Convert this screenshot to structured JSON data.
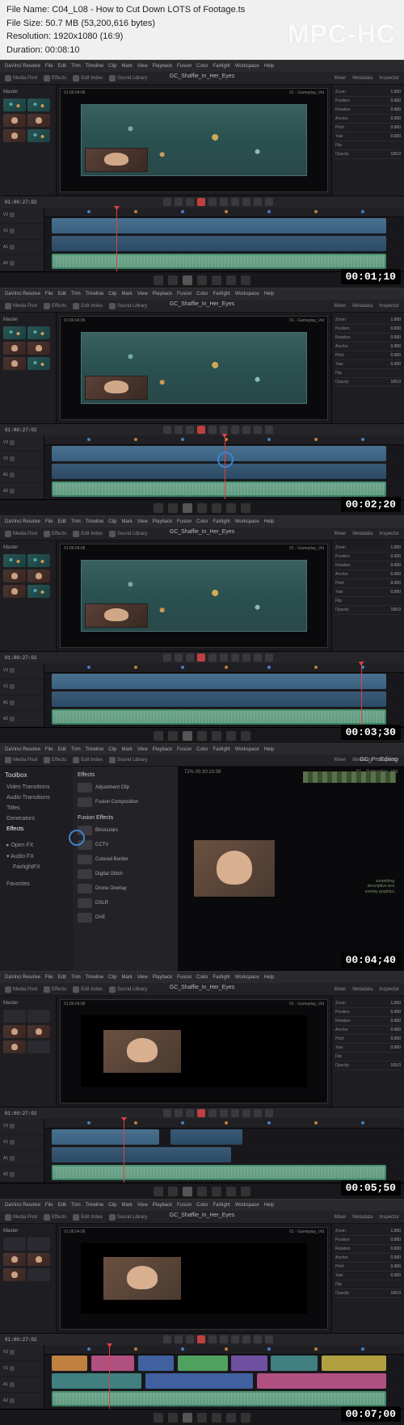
{
  "header": {
    "file_name_label": "File Name:",
    "file_name": "C04_L08 - How to Cut Down LOTS of Footage.ts",
    "file_size_label": "File Size:",
    "file_size": "50.7 MB (53,200,616 bytes)",
    "resolution_label": "Resolution:",
    "resolution": "1920x1080 (16:9)",
    "duration_label": "Duration:",
    "duration": "00:08:10",
    "watermark": "MPC-HC"
  },
  "app": {
    "name": "DaVinci Resolve",
    "menu": [
      "File",
      "Edit",
      "Trim",
      "Timeline",
      "Clip",
      "Mark",
      "View",
      "Playback",
      "Fusion",
      "Color",
      "Fairlight",
      "Workspace",
      "Help"
    ],
    "toolbar": {
      "media_pool": "Media Pool",
      "effects": "Effects",
      "edit_index": "Edit Index",
      "sound_library": "Sound Library",
      "mixer": "Mixer",
      "metadata": "Metadata",
      "inspector": "Inspector"
    },
    "project_title": "GC_Shaffie_In_Her_Eyes",
    "project_badge": "GC_ProEditing"
  },
  "media_pool": {
    "header": "Master"
  },
  "inspector": {
    "rows": [
      {
        "k": "Zoom",
        "v": "1.000"
      },
      {
        "k": "Position",
        "v": "0.000"
      },
      {
        "k": "Rotation",
        "v": "0.000"
      },
      {
        "k": "Anchor",
        "v": "0.000"
      },
      {
        "k": "Pitch",
        "v": "0.000"
      },
      {
        "k": "Yaw",
        "v": "0.000"
      },
      {
        "k": "Flip",
        "v": ""
      },
      {
        "k": "Opacity",
        "v": "100.0"
      }
    ]
  },
  "timeline": {
    "tracks": [
      "V2",
      "V1",
      "A1",
      "A2"
    ],
    "tc_label": "01:00:27:02",
    "source_tc": "01:06:04:06",
    "clip_title": "01 - Gameplay_Vid"
  },
  "effects_panel": {
    "hdr": "Toolbox",
    "categories": [
      "Video Transitions",
      "Audio Transitions",
      "Titles",
      "Generators",
      "Effects"
    ],
    "open_fx": "Open FX",
    "audio_fx": "Audio FX",
    "fairlight_fx": "FairlightFX",
    "favorites": "Favorites",
    "list_header": "Effects",
    "fusion_effects": "Fusion Effects",
    "items": [
      "Adjustment Clip",
      "Fusion Composition",
      "Binoculars",
      "CCTV",
      "Colored Border",
      "Digital Glitch",
      "Drone Overlay",
      "DSLR",
      "DVE"
    ],
    "preview_tc": "72%    00:30:10:08"
  },
  "frames": [
    {
      "ts": "00:01;10",
      "playhead": 20,
      "variant": "edit",
      "game": true
    },
    {
      "ts": "00:02;20",
      "playhead": 50,
      "variant": "edit",
      "game": true,
      "circle": true
    },
    {
      "ts": "00:03;30",
      "playhead": 88,
      "variant": "edit",
      "game": true
    },
    {
      "ts": "00:04;40",
      "variant": "effects"
    },
    {
      "ts": "00:05;50",
      "playhead": 22,
      "variant": "edit_dark"
    },
    {
      "ts": "00:07;00",
      "playhead": 18,
      "variant": "edit_color"
    }
  ]
}
